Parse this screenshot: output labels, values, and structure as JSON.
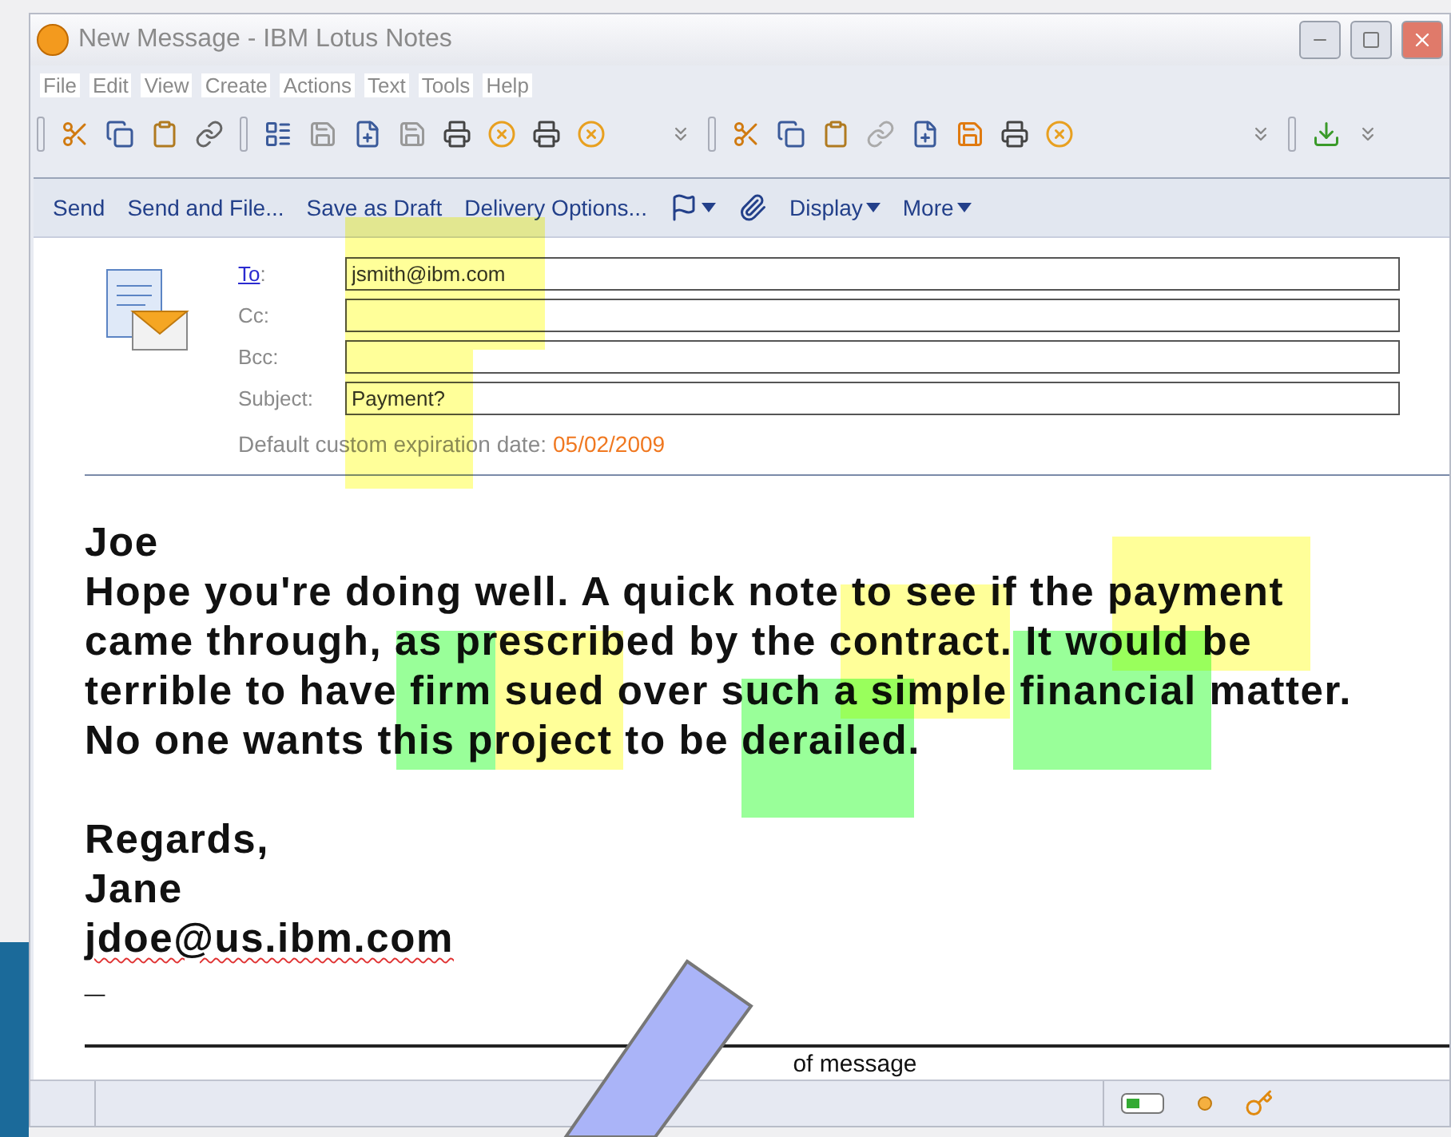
{
  "window": {
    "title": "New Message - IBM Lotus Notes"
  },
  "menu": [
    "File",
    "Edit",
    "View",
    "Create",
    "Actions",
    "Text",
    "Tools",
    "Help"
  ],
  "actions": [
    {
      "kind": "text",
      "label": "Send"
    },
    {
      "kind": "text",
      "label": "Send and File..."
    },
    {
      "kind": "text",
      "label": "Save as Draft"
    },
    {
      "kind": "text",
      "label": "Delivery Options..."
    },
    {
      "kind": "flag"
    },
    {
      "kind": "attach"
    },
    {
      "kind": "menu",
      "label": "Display"
    },
    {
      "kind": "menu",
      "label": "More"
    }
  ],
  "fields": [
    {
      "label": "To",
      "separator": ":",
      "link": true,
      "value": "jsmith@ibm.com"
    },
    {
      "label": "Cc:",
      "link": false
    },
    {
      "label": "Bcc:",
      "link": false
    },
    {
      "label": "Subject:",
      "link": false,
      "value": "Payment?"
    }
  ],
  "expiration": {
    "label": "Default custom expiration date:",
    "date": "05/02/2009"
  },
  "body": {
    "paragraphs": [
      [
        "Joe",
        "Hope you're doing well. A quick note to see if the payment",
        "came through, as prescribed by the contract. It would be",
        "terrible to have firm sued over such a simple financial matter.",
        "No one wants this project to be derailed."
      ],
      [
        "Regards,",
        "Jane"
      ]
    ],
    "signature_email": "jdoe@us.ibm.com",
    "cursor": "_"
  },
  "footer": "of message",
  "highlights": [
    {
      "color": "#ffff99"
    },
    {
      "color": "#ffff99"
    },
    {
      "color": "#ffff99"
    },
    {
      "color": "#ffff99"
    },
    {
      "color": "#ffff99"
    },
    {
      "color": "#99ff99"
    },
    {
      "color": "#99ff99"
    },
    {
      "color": "#99ff99"
    }
  ]
}
